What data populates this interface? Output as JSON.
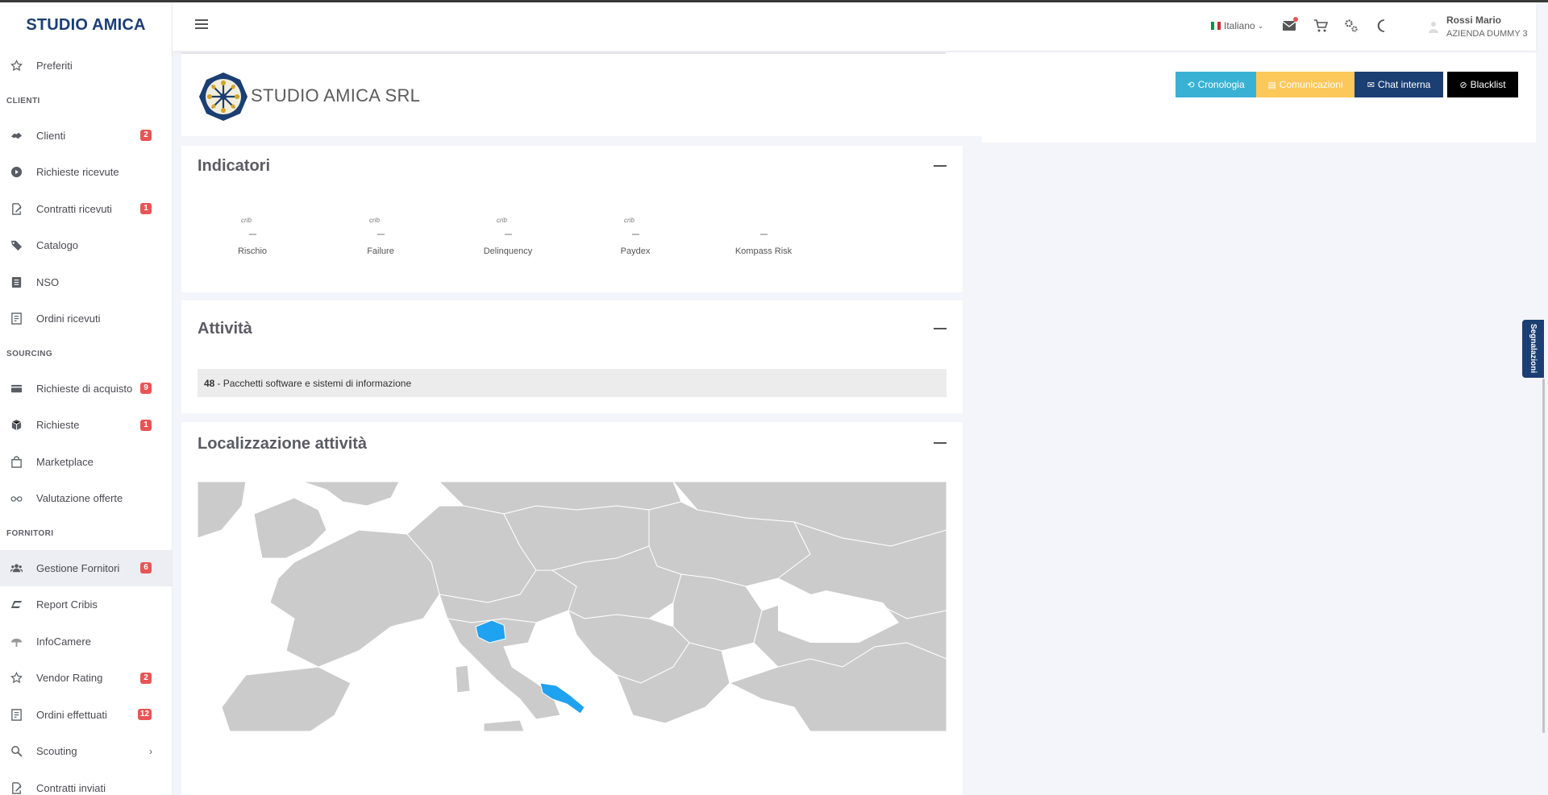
{
  "brand": "STUDIO AMICA",
  "sidebar": {
    "top_item": {
      "label": "Preferiti",
      "icon": "star-icon"
    },
    "sections": [
      {
        "title": "CLIENTI",
        "items": [
          {
            "label": "Clienti",
            "badge": "2",
            "icon": "handshake-icon"
          },
          {
            "label": "Richieste ricevute",
            "badge": "",
            "icon": "play-circle-icon"
          },
          {
            "label": "Contratti ricevuti",
            "badge": "1",
            "icon": "file-signature-icon"
          },
          {
            "label": "Catalogo",
            "badge": "",
            "icon": "tags-icon"
          },
          {
            "label": "NSO",
            "badge": "",
            "icon": "list-icon"
          },
          {
            "label": "Ordini ricevuti",
            "badge": "",
            "icon": "receipt-icon"
          }
        ]
      },
      {
        "title": "SOURCING",
        "items": [
          {
            "label": "Richieste di acquisto",
            "badge": "9",
            "icon": "credit-card-icon"
          },
          {
            "label": "Richieste",
            "badge": "1",
            "icon": "cube-icon"
          },
          {
            "label": "Marketplace",
            "badge": "",
            "icon": "shopping-bag-icon"
          },
          {
            "label": "Valutazione offerte",
            "badge": "",
            "icon": "glasses-icon"
          }
        ]
      },
      {
        "title": "FORNITORI",
        "items": [
          {
            "label": "Gestione Fornitori",
            "badge": "6",
            "icon": "users-icon",
            "active": true
          },
          {
            "label": "Report Cribis",
            "badge": "",
            "icon": "cribis-icon"
          },
          {
            "label": "InfoCamere",
            "badge": "",
            "icon": "infocamere-icon"
          },
          {
            "label": "Vendor Rating",
            "badge": "2",
            "icon": "star-icon"
          },
          {
            "label": "Ordini effettuati",
            "badge": "12",
            "icon": "receipt-icon"
          },
          {
            "label": "Scouting",
            "badge": "",
            "icon": "search-icon",
            "has_submenu": true
          },
          {
            "label": "Contratti inviati",
            "badge": "",
            "icon": "file-signature-icon"
          }
        ]
      }
    ]
  },
  "topbar": {
    "language": "Italiano",
    "user_name": "Rossi Mario",
    "user_company": "AZIENDA DUMMY 3"
  },
  "header": {
    "company_name": "STUDIO AMICA SRL",
    "buttons": [
      {
        "label": "Cronologia",
        "icon": "history-icon",
        "color": "#39b1d4"
      },
      {
        "label": "Comunicazioni",
        "icon": "inbox-icon",
        "color": "#fcc85a"
      },
      {
        "label": "Chat interna",
        "icon": "envelope-icon",
        "color": "#1b3e73"
      },
      {
        "label": "Blacklist",
        "icon": "ban-icon",
        "color": "#000000"
      }
    ]
  },
  "indicators": {
    "title": "Indicatori",
    "items": [
      {
        "label": "Rischio",
        "value": "–"
      },
      {
        "label": "Failure",
        "value": "–"
      },
      {
        "label": "Delinquency",
        "value": "–"
      },
      {
        "label": "Paydex",
        "value": "–"
      },
      {
        "label": "Kompass Risk",
        "value": "–"
      }
    ]
  },
  "activities": {
    "title": "Attività",
    "code": "48",
    "description": "- Pacchetti software e sistemi di informazione"
  },
  "localization": {
    "title": "Localizzazione attività",
    "highlighted_regions": [
      "Lombardia",
      "Puglia"
    ],
    "highlight_color": "#1fa2f0",
    "land_color": "#cbcbcb"
  },
  "side_tab": "Segnalazioni",
  "colors": {
    "brand": "#1b3e73",
    "badge": "#ea5455"
  }
}
